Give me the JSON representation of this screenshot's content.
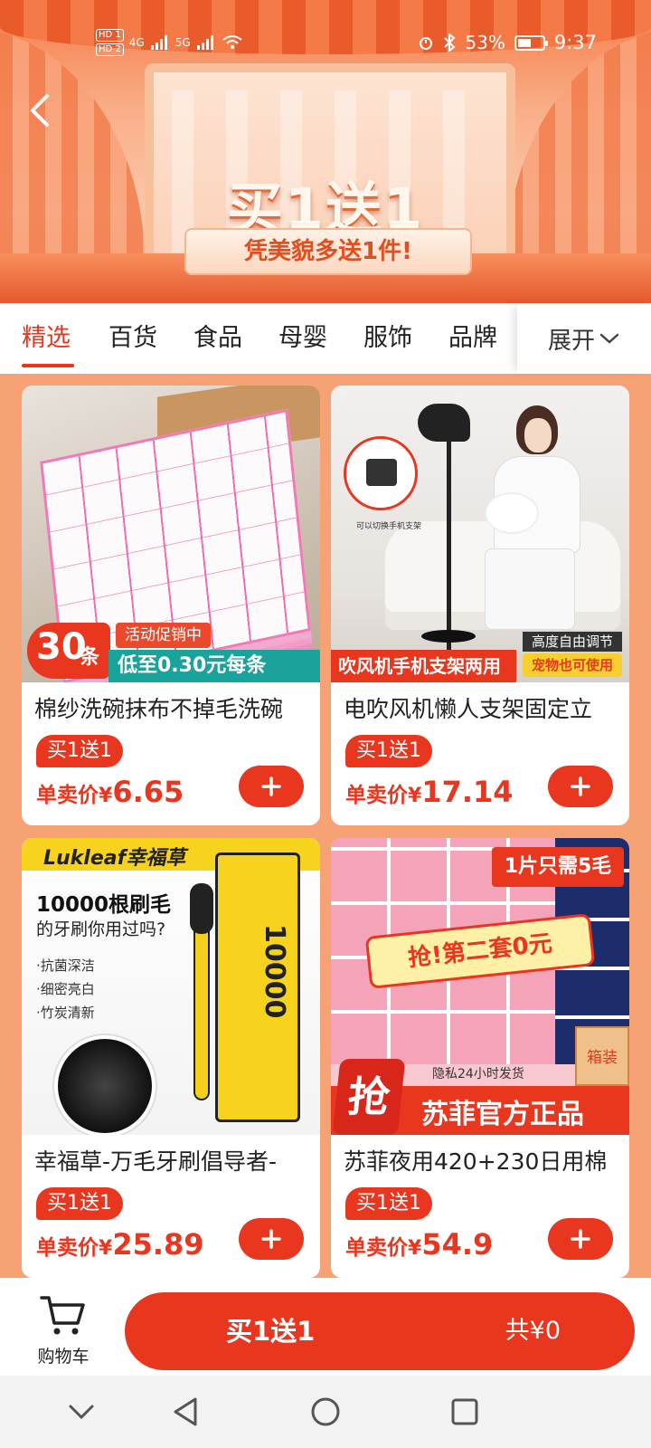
{
  "status_bar": {
    "time": "9:37",
    "battery_pct": "53%",
    "battery_level": 0.53,
    "sim1": "HD 1",
    "sim2": "HD 2",
    "net1": "4G",
    "net2": "5G"
  },
  "banner": {
    "headline": "买1送1",
    "subline": "凭美貌多送1件!"
  },
  "tabs": [
    {
      "label": "精选",
      "active": true
    },
    {
      "label": "百货",
      "active": false
    },
    {
      "label": "食品",
      "active": false
    },
    {
      "label": "母婴",
      "active": false
    },
    {
      "label": "服饰",
      "active": false
    },
    {
      "label": "品牌",
      "active": false
    }
  ],
  "expand_label": "展开",
  "products": [
    {
      "title": "棉纱洗碗抹布不掉毛洗碗",
      "promo": "买1送1",
      "price_label": "单卖价",
      "currency": "¥",
      "price": "6.65",
      "image_text": {
        "count": "30",
        "unit": "条",
        "activity": "活动促销中",
        "bar": "低至0.30元每条"
      }
    },
    {
      "title": "电吹风机懒人支架固定立",
      "promo": "买1送1",
      "price_label": "单卖价",
      "currency": "¥",
      "price": "17.14",
      "image_text": {
        "zoom_caption": "可以切换手机支架",
        "bar": "吹风机手机支架两用",
        "tag1": "高度自由调节",
        "tag2": "宠物也可使用"
      }
    },
    {
      "title": "幸福草-万毛牙刷倡导者-",
      "promo": "买1送1",
      "price_label": "单卖价",
      "currency": "¥",
      "price": "25.89",
      "image_text": {
        "brand": "Lukleaf幸福草",
        "headline": "10000根刷毛",
        "sub": "的牙刷你用过吗?",
        "b1": "·抗菌深洁",
        "b2": "·细密亮白",
        "b3": "·竹炭清新",
        "box_num": "10000"
      }
    },
    {
      "title": "苏菲夜用420+230日用棉",
      "promo": "买1送1",
      "price_label": "单卖价",
      "currency": "¥",
      "price": "54.9",
      "image_text": {
        "banner": "1片只需5毛",
        "grab": "抢!第二套0元",
        "privacy": "隐私24小时发货",
        "qiang": "抢",
        "official": "苏菲官方正品",
        "box": "箱装"
      }
    }
  ],
  "bottom_bar": {
    "cart_label": "购物车",
    "cta_label": "买1送1",
    "total": "共¥0"
  },
  "colors": {
    "accent": "#e8361f",
    "page_bg": "#f6a274",
    "teal": "#19a39a",
    "yellow": "#f7d31e"
  },
  "icons": {
    "back": "chevron-left-icon",
    "add": "plus-icon",
    "cart": "shopping-cart-icon",
    "expand": "chevron-down-icon",
    "nav_back": "triangle-back-icon",
    "nav_home": "circle-home-icon",
    "nav_recent": "square-recent-icon",
    "nav_hide": "chevron-down-icon"
  }
}
